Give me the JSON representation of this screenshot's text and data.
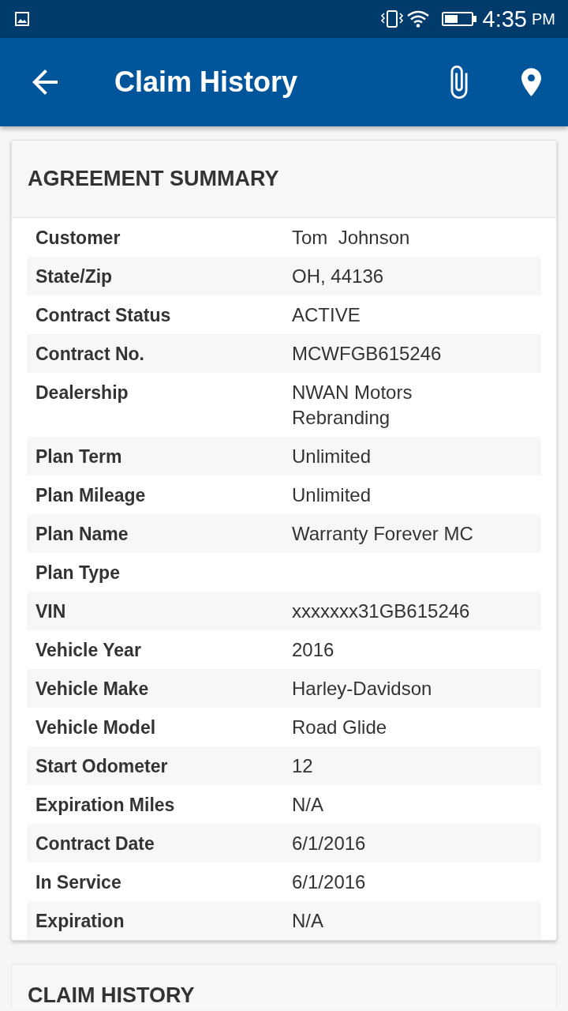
{
  "status_bar": {
    "time": "4:35",
    "period": "PM"
  },
  "app_bar": {
    "title": "Claim History"
  },
  "sections": [
    {
      "title": "AGREEMENT SUMMARY",
      "rows": [
        {
          "label": "Customer",
          "value": "Tom  Johnson"
        },
        {
          "label": "State/Zip",
          "value": "OH, 44136"
        },
        {
          "label": "Contract Status",
          "value": "ACTIVE"
        },
        {
          "label": "Contract No.",
          "value": "MCWFGB615246"
        },
        {
          "label": "Dealership",
          "value": "NWAN Motors Rebranding"
        },
        {
          "label": "Plan Term",
          "value": "Unlimited"
        },
        {
          "label": "Plan Mileage",
          "value": "Unlimited"
        },
        {
          "label": "Plan Name",
          "value": "Warranty Forever MC"
        },
        {
          "label": "Plan Type"
        },
        {
          "label": "VIN",
          "value": "xxxxxxx31GB615246"
        },
        {
          "label": "Vehicle Year",
          "value": "2016"
        },
        {
          "label": "Vehicle Make",
          "value": "Harley-Davidson"
        },
        {
          "label": "Vehicle Model",
          "value": "Road Glide"
        },
        {
          "label": "Start Odometer",
          "value": "12"
        },
        {
          "label": "Expiration Miles",
          "value": "N/A"
        },
        {
          "label": "Contract Date",
          "value": "6/1/2016"
        },
        {
          "label": "In Service",
          "value": "6/1/2016"
        },
        {
          "label": "Expiration",
          "value": "N/A"
        }
      ]
    },
    {
      "title": "CLAIM HISTORY"
    }
  ]
}
